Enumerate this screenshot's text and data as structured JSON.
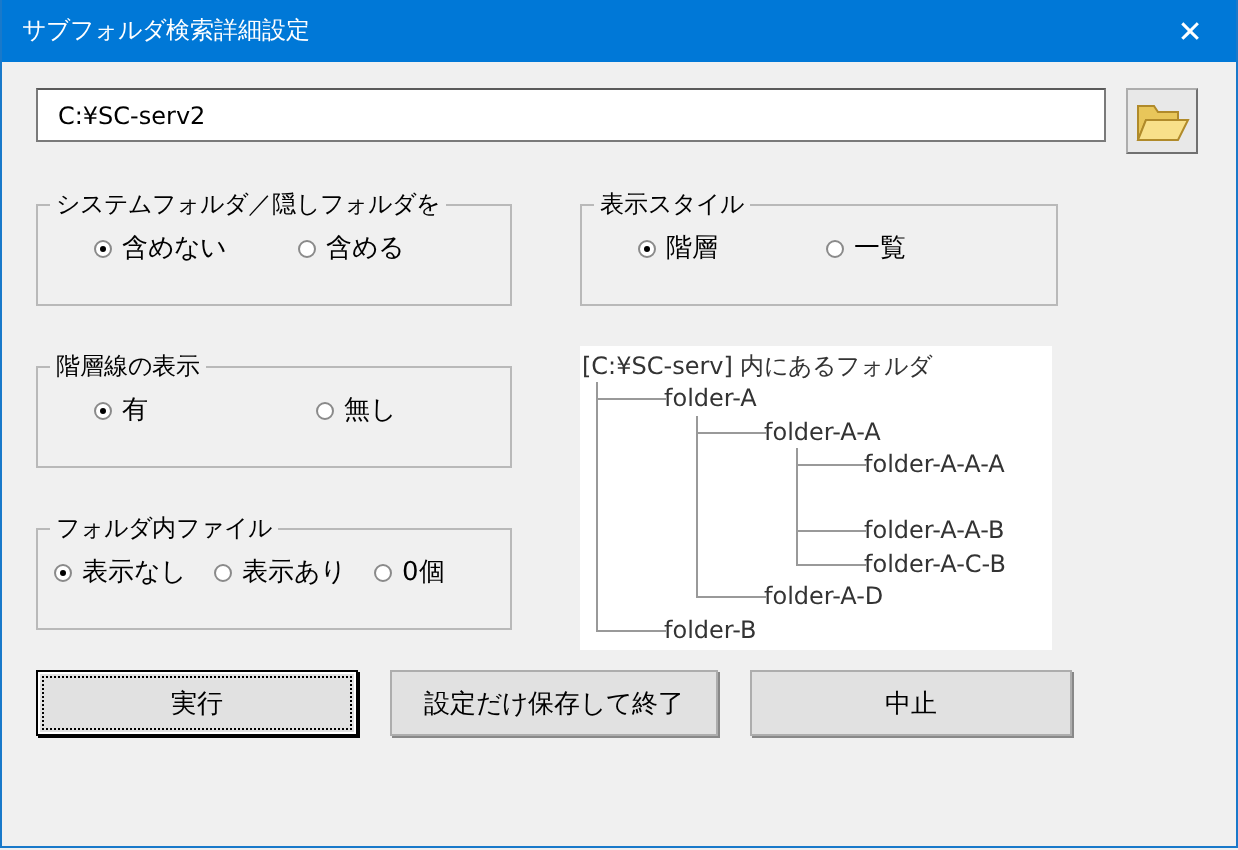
{
  "window": {
    "title": "サブフォルダ検索詳細設定",
    "close": "✕"
  },
  "path_field": {
    "value": "C:¥SC-serv2"
  },
  "groups_left": [
    {
      "title": "システムフォルダ／隠しフォルダを",
      "options": [
        {
          "label": "含めない",
          "selected": true
        },
        {
          "label": "含める",
          "selected": false
        }
      ]
    },
    {
      "title": "階層線の表示",
      "options": [
        {
          "label": "有",
          "selected": true
        },
        {
          "label": "無し",
          "selected": false
        }
      ]
    },
    {
      "title": "フォルダ内ファイル",
      "options": [
        {
          "label": "表示なし",
          "selected": true
        },
        {
          "label": "表示あり",
          "selected": false
        },
        {
          "label": "0個",
          "selected": false
        }
      ]
    }
  ],
  "display_style": {
    "title": "表示スタイル",
    "options": [
      {
        "label": "階層",
        "selected": true
      },
      {
        "label": "一覧",
        "selected": false
      }
    ]
  },
  "preview": {
    "title": "[C:¥SC-serv] 内にあるフォルダ",
    "tree": [
      {
        "kind": "folder",
        "name": "folder-A",
        "children": [
          {
            "kind": "folder",
            "name": "folder-A-A",
            "children": [
              {
                "kind": "folder",
                "name": "folder-A-A-A"
              },
              {
                "kind": "blank"
              },
              {
                "kind": "folder",
                "name": "folder-A-A-B"
              },
              {
                "kind": "folder",
                "name": "folder-A-C-B"
              }
            ]
          },
          {
            "kind": "folder",
            "name": "folder-A-D"
          }
        ]
      },
      {
        "kind": "folder",
        "name": "folder-B"
      }
    ]
  },
  "buttons": [
    {
      "label": "実行",
      "selected": true
    },
    {
      "label": "設定だけ保存して終了",
      "selected": false
    },
    {
      "label": "中止",
      "selected": false
    }
  ]
}
